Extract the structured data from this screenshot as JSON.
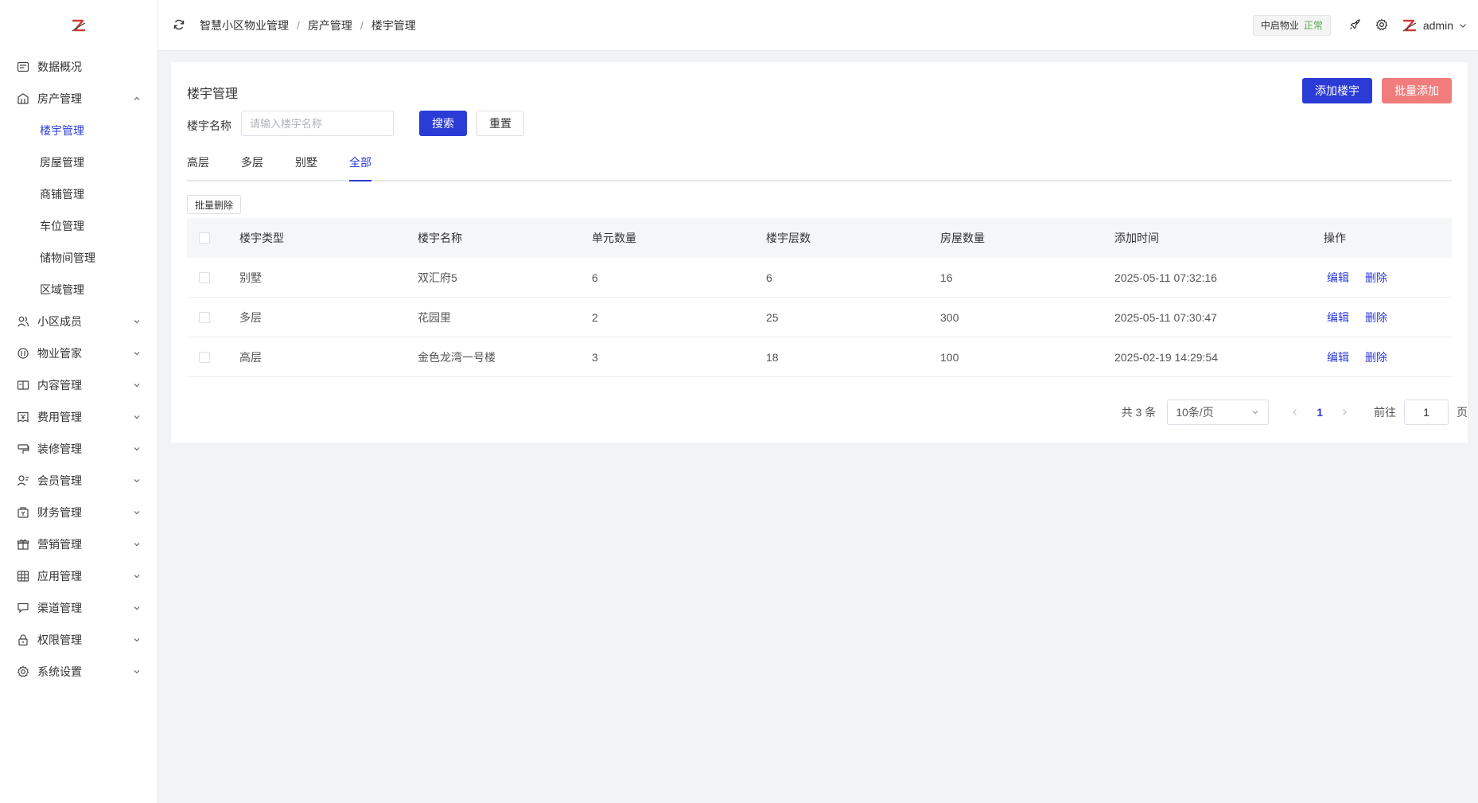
{
  "sidebar": {
    "items": [
      {
        "label": "数据概况",
        "icon": "dashboard-icon"
      },
      {
        "label": "房产管理",
        "icon": "building-icon",
        "expanded": true,
        "children": [
          {
            "label": "楼宇管理",
            "active": true
          },
          {
            "label": "房屋管理"
          },
          {
            "label": "商铺管理"
          },
          {
            "label": "车位管理"
          },
          {
            "label": "储物间管理"
          },
          {
            "label": "区域管理"
          }
        ]
      },
      {
        "label": "小区成员",
        "icon": "users-icon"
      },
      {
        "label": "物业管家",
        "icon": "steward-icon"
      },
      {
        "label": "内容管理",
        "icon": "content-icon"
      },
      {
        "label": "费用管理",
        "icon": "fee-icon"
      },
      {
        "label": "装修管理",
        "icon": "decor-icon"
      },
      {
        "label": "会员管理",
        "icon": "member-icon"
      },
      {
        "label": "财务管理",
        "icon": "finance-icon"
      },
      {
        "label": "营销管理",
        "icon": "gift-icon"
      },
      {
        "label": "应用管理",
        "icon": "app-icon"
      },
      {
        "label": "渠道管理",
        "icon": "channel-icon"
      },
      {
        "label": "权限管理",
        "icon": "lock-icon"
      },
      {
        "label": "系统设置",
        "icon": "gear-icon"
      }
    ]
  },
  "topbar": {
    "breadcrumb": [
      "智慧小区物业管理",
      "房产管理",
      "楼宇管理"
    ],
    "org_name": "中启物业",
    "org_status": "正常",
    "username": "admin"
  },
  "page": {
    "title": "楼宇管理",
    "add_button": "添加楼宇",
    "batch_add_button": "批量添加",
    "filter_label": "楼宇名称",
    "filter_placeholder": "请输入楼宇名称",
    "filter_value": "",
    "search_button": "搜索",
    "reset_button": "重置",
    "tabs": [
      {
        "label": "高层"
      },
      {
        "label": "多层"
      },
      {
        "label": "别墅"
      },
      {
        "label": "全部",
        "active": true
      }
    ],
    "bulk_delete_button": "批量删除"
  },
  "table": {
    "columns": [
      "楼宇类型",
      "楼宇名称",
      "单元数量",
      "楼宇层数",
      "房屋数量",
      "添加时间",
      "操作"
    ],
    "rows": [
      {
        "type": "别墅",
        "name": "双汇府5",
        "units": "6",
        "floors": "6",
        "houses": "16",
        "added": "2025-05-11 07:32:16"
      },
      {
        "type": "多层",
        "name": "花园里",
        "units": "2",
        "floors": "25",
        "houses": "300",
        "added": "2025-05-11 07:30:47"
      },
      {
        "type": "高层",
        "name": "金色龙湾一号楼",
        "units": "3",
        "floors": "18",
        "houses": "100",
        "added": "2025-02-19 14:29:54"
      }
    ],
    "edit_label": "编辑",
    "delete_label": "删除"
  },
  "pagination": {
    "total_text": "共 3 条",
    "page_size": "10条/页",
    "current_page": "1",
    "goto_label": "前往",
    "goto_value": "1",
    "goto_unit": "页"
  },
  "colors": {
    "primary": "#2b3bd6",
    "danger": "#f07c7c",
    "status_ok": "#52a84a"
  }
}
